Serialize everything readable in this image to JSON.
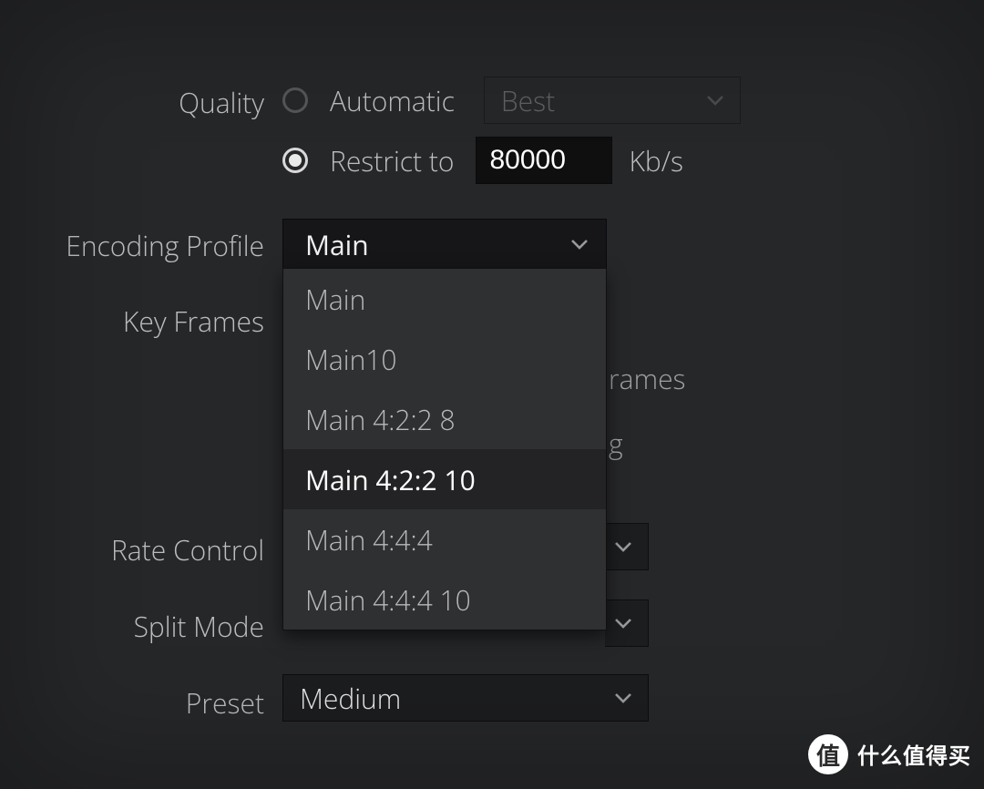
{
  "labels": {
    "quality": "Quality",
    "encoding_profile": "Encoding Profile",
    "key_frames": "Key Frames",
    "rate_control": "Rate Control",
    "split_mode": "Split Mode",
    "preset": "Preset"
  },
  "quality": {
    "automatic_label": "Automatic",
    "automatic_select": "Best",
    "restrict_label": "Restrict to",
    "restrict_value": "80000",
    "restrict_unit": "Kb/s",
    "selected": "restrict"
  },
  "encoding_profile": {
    "selected": "Main",
    "options": [
      "Main",
      "Main10",
      "Main 4:2:2 8",
      "Main 4:2:2 10",
      "Main 4:4:4",
      "Main 4:4:4 10"
    ],
    "highlighted_index": 3
  },
  "obscured": {
    "checkbox_a_fragment": "rames",
    "checkbox_b_fragment": "g"
  },
  "preset": {
    "value": "Medium"
  },
  "watermark": {
    "badge": "值",
    "text": "什么值得买"
  }
}
